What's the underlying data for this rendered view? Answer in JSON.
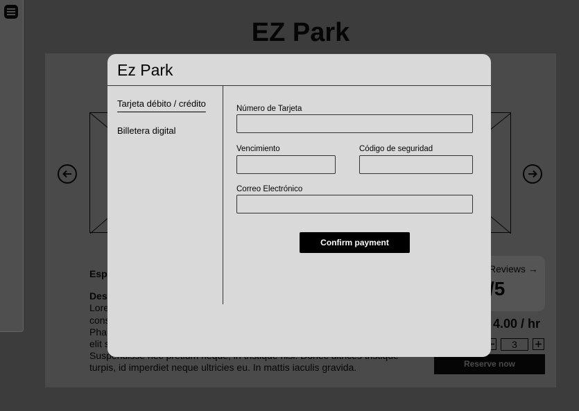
{
  "app": {
    "title": "EZ Park"
  },
  "listing": {
    "name_partial": "Esp",
    "desc_label_partial": "Des",
    "desc_lines": [
      "Lore",
      "cons",
      "Pha",
      "elit s",
      "Suspendisse nec pretium neque, in tristique nisi. Donec ultrices tristique",
      "turpis, id imperdiet neque ultricies eu. In mattis iaculis gravida."
    ],
    "reviews_link": "Reviews →",
    "rating": "/5",
    "price": "4.00 / hr",
    "quantity": "3",
    "reserve_label": "Reserve now"
  },
  "icons": {
    "menu": "menu-icon",
    "prev": "arrow-left-circle-icon",
    "next": "arrow-right-circle-icon",
    "minus": "minus-icon",
    "plus": "plus-icon"
  },
  "modal": {
    "title": "Ez Park",
    "tabs": [
      {
        "label": "Tarjeta débito / crédito",
        "active": true
      },
      {
        "label": "Billetera digital",
        "active": false
      }
    ],
    "fields": {
      "card_number": {
        "label": "Número de Tarjeta",
        "value": ""
      },
      "expiry": {
        "label": "Vencimiento",
        "value": ""
      },
      "security_code": {
        "label": "Código de seguridad",
        "value": ""
      },
      "email": {
        "label": "Correo Electrónico",
        "value": ""
      }
    },
    "confirm_label": "Confirm payment"
  },
  "colors": {
    "overlay_bg": "#3c3c3c",
    "modal_bg": "#d9d9d9",
    "primary_button": "#000000"
  }
}
